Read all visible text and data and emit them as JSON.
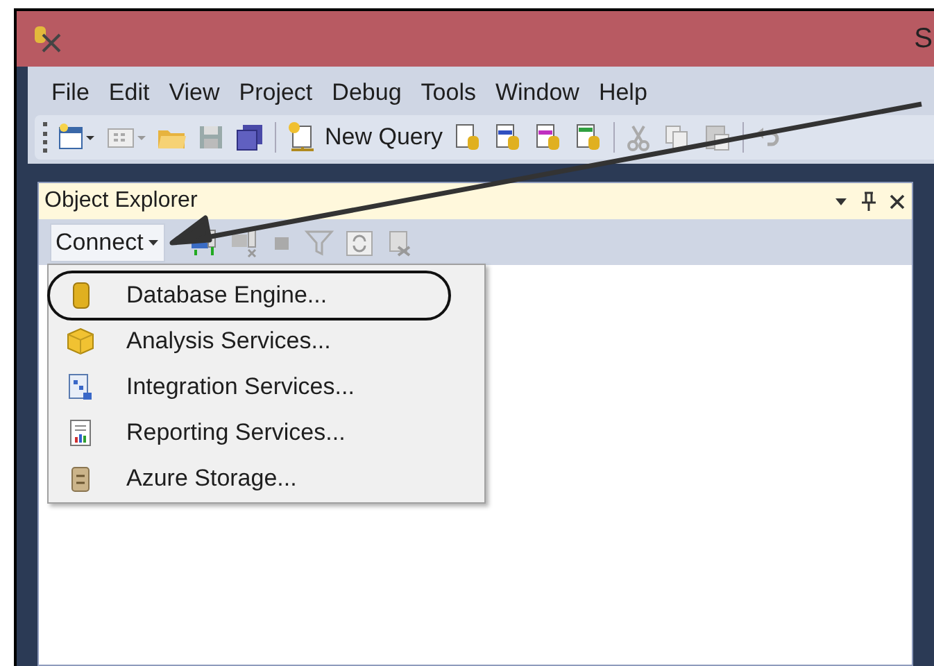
{
  "window": {
    "title": "S"
  },
  "menu_bar": [
    "File",
    "Edit",
    "View",
    "Project",
    "Debug",
    "Tools",
    "Window",
    "Help"
  ],
  "toolbar": {
    "new_query": "New Query"
  },
  "object_explorer": {
    "title": "Object Explorer",
    "connect": "Connect",
    "connect_menu": [
      {
        "label": "Database Engine...",
        "highlighted": true
      },
      {
        "label": "Analysis Services...",
        "highlighted": false
      },
      {
        "label": "Integration Services...",
        "highlighted": false
      },
      {
        "label": "Reporting Services...",
        "highlighted": false
      },
      {
        "label": "Azure Storage...",
        "highlighted": false
      }
    ]
  }
}
